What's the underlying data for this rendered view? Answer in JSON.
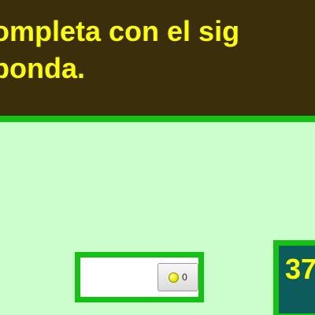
{
  "instruction": {
    "line1": "ompleta con el sig",
    "line2": "ponda."
  },
  "answer": {
    "value": "",
    "check_count": "0"
  },
  "score": {
    "value": "37"
  },
  "colors": {
    "background": "#ccfdcc",
    "panel": "#3b2e0a",
    "border": "#14c214",
    "text": "#ffff00",
    "score_bg": "#0d5c5c"
  }
}
